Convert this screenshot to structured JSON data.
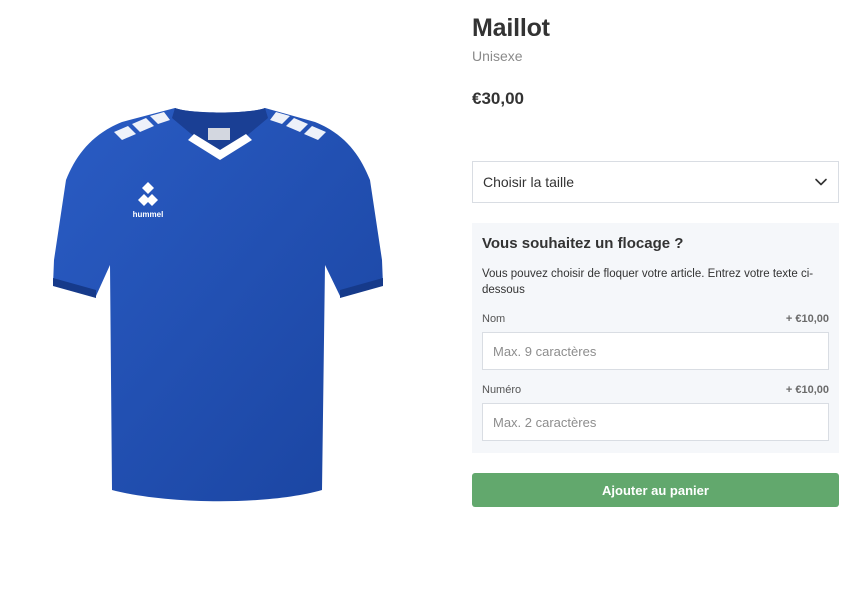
{
  "product": {
    "title": "Maillot",
    "subtitle": "Unisexe",
    "price": "€30,00",
    "image_alt": "hummel"
  },
  "size_select": {
    "label": "Choisir la taille",
    "icon": "chevron-down-icon"
  },
  "flocage": {
    "heading": "Vous souhaitez un flocage ?",
    "description": "Vous pouvez choisir de floquer votre article. Entrez votre texte ci-dessous",
    "fields": [
      {
        "label": "Nom",
        "price": "+ €10,00",
        "placeholder": "Max. 9 caractères",
        "value": ""
      },
      {
        "label": "Numéro",
        "price": "+ €10,00",
        "placeholder": "Max. 2 caractères",
        "value": ""
      }
    ]
  },
  "actions": {
    "add_to_cart": "Ajouter au panier",
    "button_color": "#62a86d"
  },
  "colors": {
    "jersey_blue": "#1f4fb0",
    "panel_bg": "#f5f7fa"
  }
}
